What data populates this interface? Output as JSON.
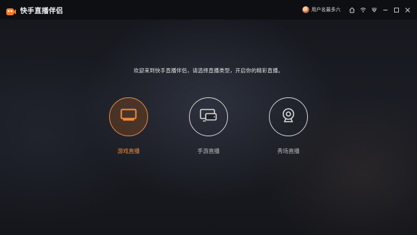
{
  "app": {
    "title": "快手直播伴侣",
    "logo_icon": "kuaishou-logo-icon",
    "accent": "#f08b3a"
  },
  "titlebar": {
    "username": "用户名最多六",
    "buttons": [
      {
        "name": "home-icon"
      },
      {
        "name": "wifi-icon"
      },
      {
        "name": "menu-dropdown-icon"
      },
      {
        "name": "minimize-icon"
      },
      {
        "name": "maximize-icon"
      },
      {
        "name": "close-icon"
      }
    ]
  },
  "main": {
    "prompt": "欢迎来到快手直播伴侣，请选择直播类型，开启你的精彩直播。",
    "options": [
      {
        "label": "游戏直播",
        "icon": "monitor-icon",
        "selected": true
      },
      {
        "label": "手游直播",
        "icon": "mobile-screen-icon",
        "selected": false
      },
      {
        "label": "秀场直播",
        "icon": "webcam-icon",
        "selected": false
      }
    ]
  }
}
